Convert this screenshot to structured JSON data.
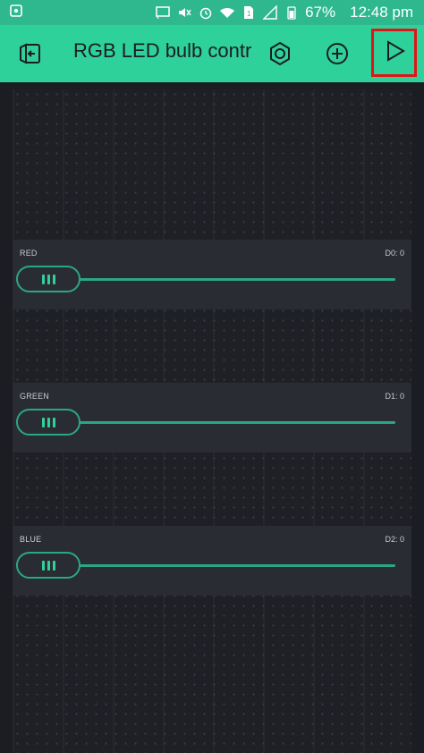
{
  "status": {
    "battery": "67%",
    "time": "12:48 pm"
  },
  "toolbar": {
    "title": "RGB LED bulb contrc",
    "back_icon": "exit-icon",
    "settings_icon": "hexagon-nut-icon",
    "add_icon": "plus-circle-icon",
    "play_icon": "play-icon"
  },
  "colors": {
    "accent": "#2fd19b",
    "status_bar": "#2fb88e",
    "background": "#1c1d22",
    "widget": "#2a2c33",
    "track": "#2aa785",
    "highlight": "#e01515"
  },
  "widgets": [
    {
      "label": "RED",
      "pin": "D0: 0",
      "value_fraction": 0
    },
    {
      "label": "GREEN",
      "pin": "D1: 0",
      "value_fraction": 0
    },
    {
      "label": "BLUE",
      "pin": "D2: 0",
      "value_fraction": 0
    }
  ]
}
